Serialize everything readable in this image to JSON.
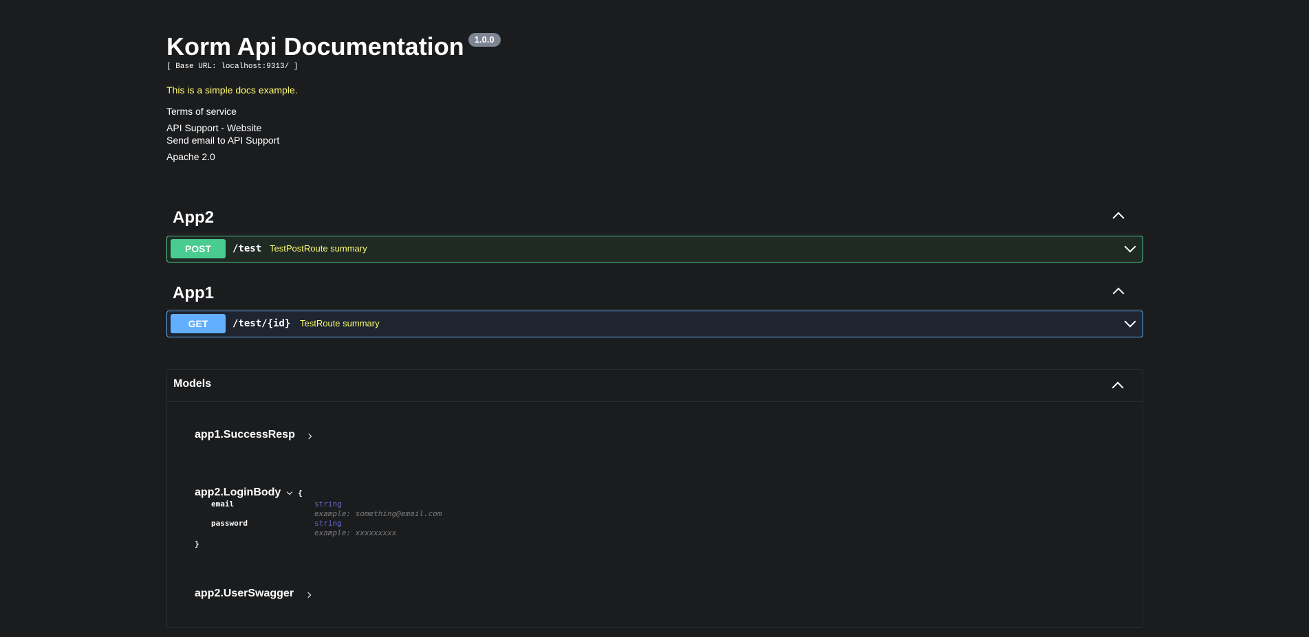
{
  "info": {
    "title": "Korm Api Documentation",
    "version": "1.0.0",
    "base_url": "[ Base URL: localhost:9313/ ]",
    "description": "This is a simple docs example.",
    "terms": "Terms of service",
    "support_website": "API Support - Website",
    "support_email": "Send email to API Support",
    "license": "Apache 2.0"
  },
  "tags": [
    {
      "name": "App2",
      "operations": [
        {
          "method": "POST",
          "path": "/test",
          "summary": "TestPostRoute summary"
        }
      ]
    },
    {
      "name": "App1",
      "operations": [
        {
          "method": "GET",
          "path": "/test/{id}",
          "summary": "TestRoute summary"
        }
      ]
    }
  ],
  "models": {
    "title": "Models",
    "items": [
      {
        "name": "app1.SuccessResp"
      },
      {
        "name": "app2.LoginBody",
        "open_brace": "{",
        "close_brace": "}",
        "properties": [
          {
            "name": "email",
            "type": "string",
            "example": "example: something@email.com"
          },
          {
            "name": "password",
            "type": "string",
            "example": "example: xxxxxxxxx"
          }
        ]
      },
      {
        "name": "app2.UserSwagger"
      }
    ]
  },
  "colors": {
    "background": "#1b1c1e",
    "post": "#49cc90",
    "get": "#61affe",
    "summary": "#fdfd70"
  }
}
